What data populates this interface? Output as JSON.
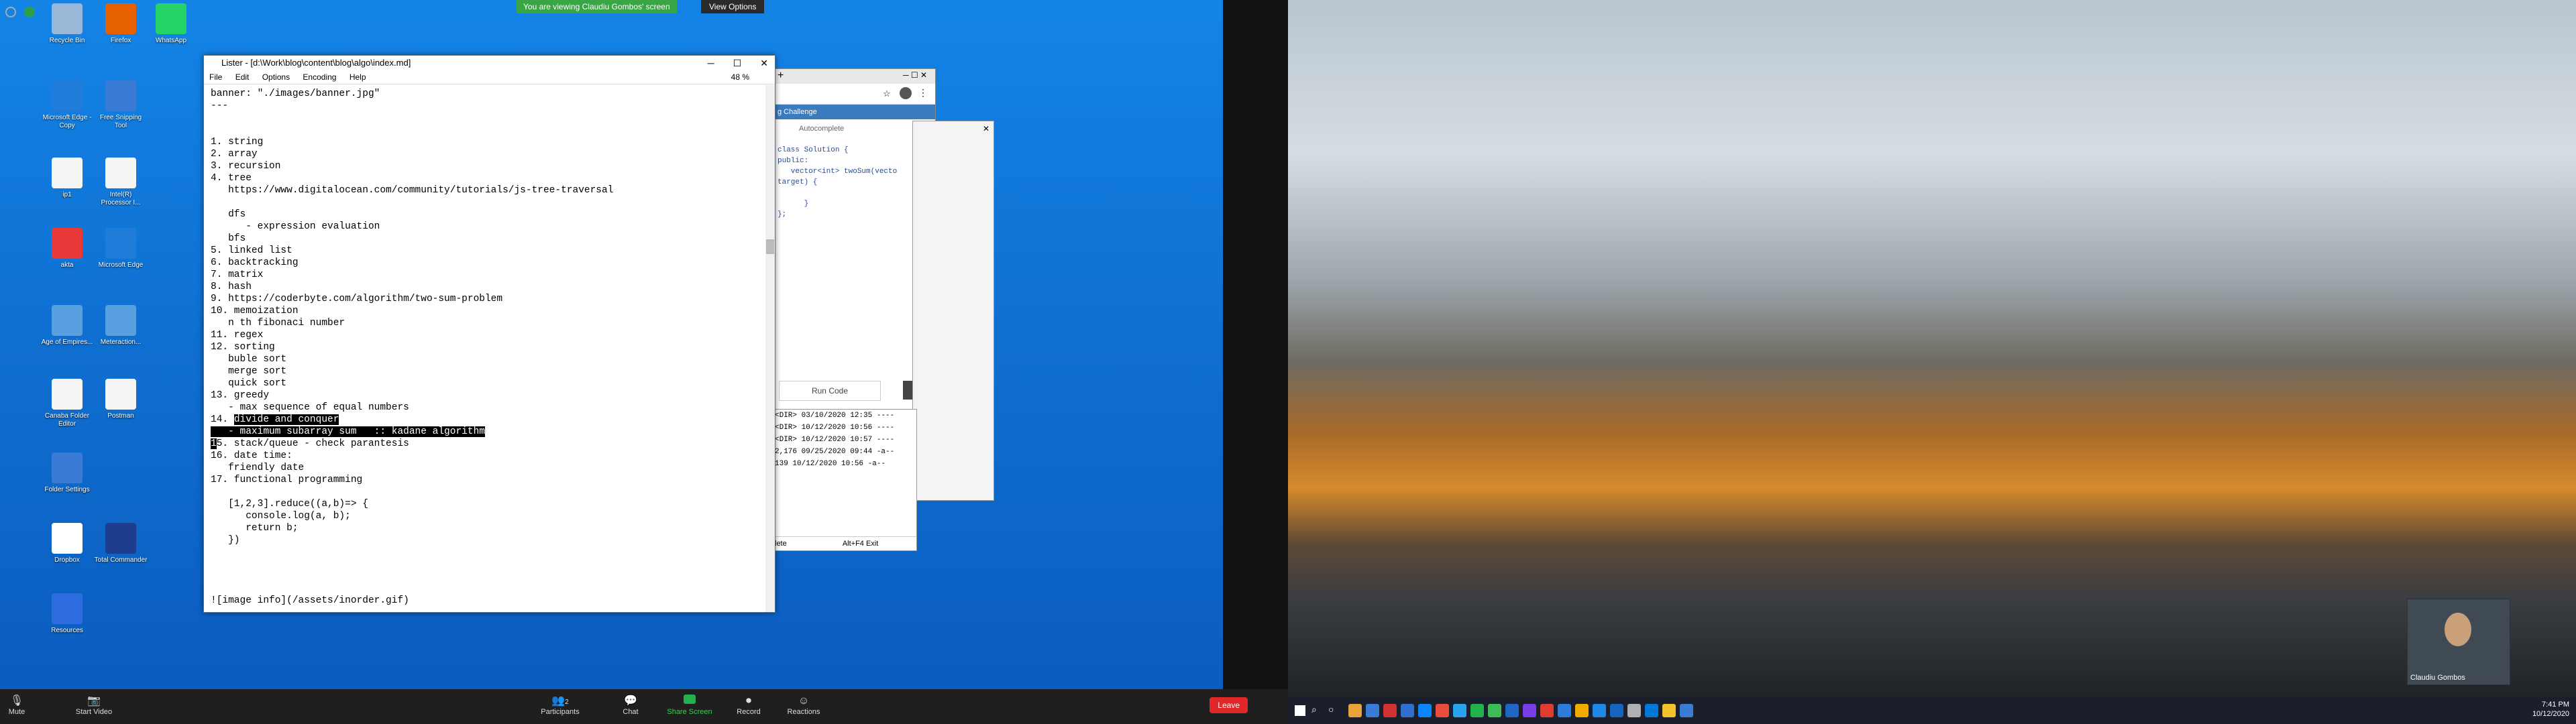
{
  "banner": {
    "viewing": "You are viewing Claudiu Gombos' screen",
    "view_options": "View Options"
  },
  "desktop_icons": [
    {
      "label": "Recycle Bin",
      "color": "#9ab7d8"
    },
    {
      "label": "Firefox",
      "color": "#e66000"
    },
    {
      "label": "WhatsApp",
      "color": "#25d366"
    },
    {
      "label": "Microsoft Edge - Copy",
      "color": "#1f7cd8"
    },
    {
      "label": "Free Snipping Tool",
      "color": "#3a7bd5"
    },
    {
      "label": "ip1",
      "color": "#f5f5f5"
    },
    {
      "label": "Intel(R) Processor I...",
      "color": "#f5f5f5"
    },
    {
      "label": "akta",
      "color": "#e83838"
    },
    {
      "label": "Microsoft Edge",
      "color": "#1f7cd8"
    },
    {
      "label": "Age of Empires...",
      "color": "#5aa0e0"
    },
    {
      "label": "Meteraction...",
      "color": "#5aa0e0"
    },
    {
      "label": "Canaba Folder Editor",
      "color": "#f5f5f5"
    },
    {
      "label": "Postman",
      "color": "#f5f5f5"
    },
    {
      "label": "Folder Settings",
      "color": "#3a7bd5"
    },
    {
      "label": "Dropbox",
      "color": "#ffffff"
    },
    {
      "label": "Total Commander",
      "color": "#1e3d8f"
    },
    {
      "label": "Resources",
      "color": "#2d6cdf"
    }
  ],
  "lister": {
    "title": "Lister - [d:\\Work\\blog\\content\\blog\\algo\\index.md]",
    "menu": [
      "File",
      "Edit",
      "Options",
      "Encoding",
      "Help"
    ],
    "percent": "48 %",
    "lines_before": "banner: \"./images/banner.jpg\"\n---\n\n\n1. string\n2. array\n3. recursion\n4. tree\n   https://www.digitalocean.com/community/tutorials/js-tree-traversal\n\n   dfs\n      - expression evaluation\n   bfs\n5. linked list\n6. backtracking\n7. matrix\n8. hash\n9. https://coderbyte.com/algorithm/two-sum-problem\n10. memoization\n   n th fibonaci number\n11. regex\n12. sorting\n   buble sort\n   merge sort\n   quick sort\n13. greedy\n   - max sequence of equal numbers\n14. ",
    "hl_1": "divide and conquer",
    "hl_2": "   - maximum subarray sum   :: kadane algorithm",
    "hl_3": "1",
    "lines_after": "5. stack/queue - check parantesis\n16. date time:\n   friendly date\n17. functional programming\n\n   [1,2,3].reduce((a,b)=> {\n      console.log(a, b);\n      return b;\n   })\n\n\n\n\n![image info](/assets/inorder.gif)"
  },
  "browser": {
    "tab": "g Challenge",
    "autocomplete": "Autocomplete",
    "code": "class Solution {\npublic:\n   vector<int> twoSum(vecto\ntarget) {\n\n      }\n};",
    "run_code": "Run Code"
  },
  "explorer": {
    "rows": [
      "<DIR>  03/10/2020 12:35  ----",
      "<DIR>  10/12/2020 10:56  ----",
      "<DIR>  10/12/2020 10:57  ----",
      "2,176  09/25/2020 09:44  -a--",
      "139  10/12/2020 10:56  -a--"
    ],
    "delete": "lete",
    "exit": "Alt+F4 Exit"
  },
  "zoom_bar": {
    "mute": "Mute",
    "start_video": "Start Video",
    "participants": "Participants",
    "participants_count": "2",
    "chat": "Chat",
    "share_screen": "Share Screen",
    "record": "Record",
    "reactions": "Reactions",
    "leave": "Leave"
  },
  "camera": {
    "name": "Claudiu Gombos"
  },
  "clock": {
    "time": "7:41 PM",
    "date": "10/12/2020"
  }
}
